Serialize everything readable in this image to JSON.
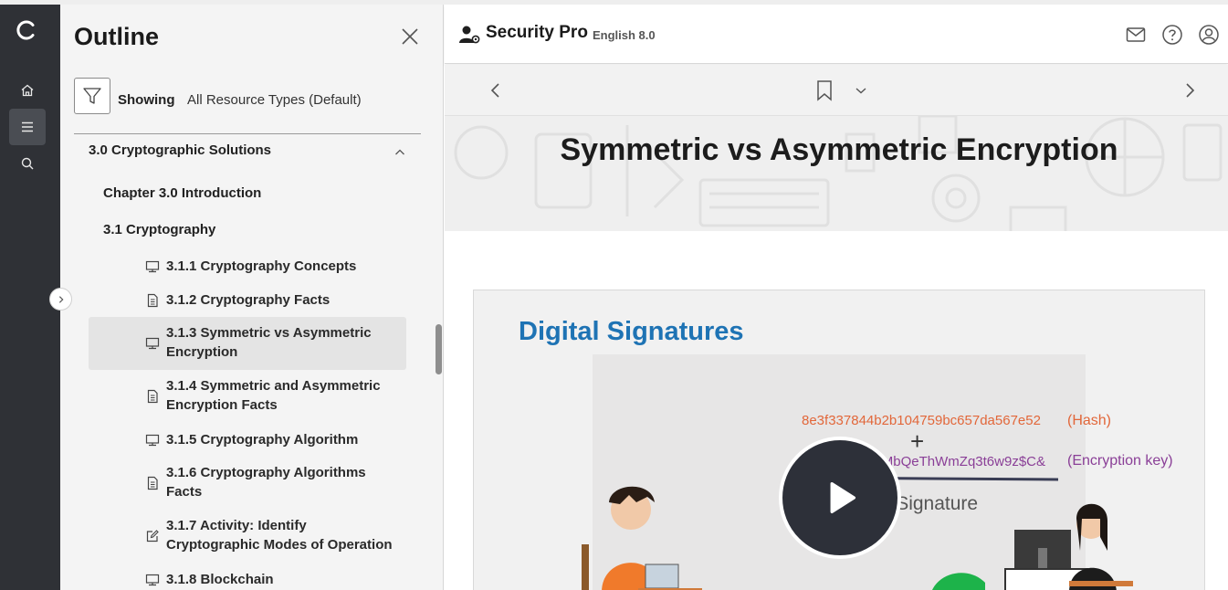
{
  "outline": {
    "title": "Outline",
    "showing_label": "Showing",
    "showing_value": "All Resource Types (Default)",
    "section": "3.0 Cryptographic Solutions",
    "chapters": [
      "Chapter 3.0 Introduction",
      "3.1 Cryptography"
    ],
    "items": [
      {
        "label": "3.1.1 Cryptography Concepts",
        "icon": "video-icon"
      },
      {
        "label": "3.1.2 Cryptography Facts",
        "icon": "document-icon"
      },
      {
        "label": "3.1.3 Symmetric vs Asymmetric Encryption",
        "icon": "video-icon",
        "selected": true
      },
      {
        "label": "3.1.4 Symmetric and Asymmetric Encryption Facts",
        "icon": "document-icon"
      },
      {
        "label": "3.1.5 Cryptography Algorithm",
        "icon": "video-icon"
      },
      {
        "label": "3.1.6 Cryptography Algorithms Facts",
        "icon": "document-icon"
      },
      {
        "label": "3.1.7 Activity: Identify Cryptographic Modes of Operation",
        "icon": "edit-icon"
      },
      {
        "label": "3.1.8 Blockchain",
        "icon": "video-icon"
      }
    ]
  },
  "header": {
    "app_name": "Security Pro",
    "language": "English 8.0"
  },
  "main": {
    "page_title": "Symmetric vs Asymmetric Encryption"
  },
  "video": {
    "title": "Digital Signatures",
    "hash": "8e3f337844b2b104759bc657da567e52",
    "hash_label": "(Hash)",
    "plus": "+",
    "enc_key": "5v8y/B EIH+MbQeThWmZq3t6w9z$C&",
    "enc_label": "(Encryption key)",
    "signature": "Digital Signature"
  },
  "colors": {
    "rail_bg": "#2f3136",
    "video_title": "#1e73b4",
    "hash_color": "#e2673a",
    "key_color": "#8a3f97"
  }
}
